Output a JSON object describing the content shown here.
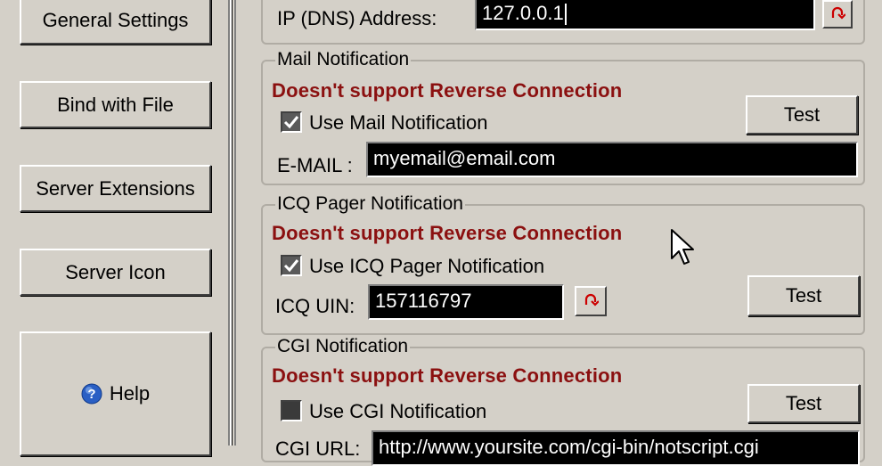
{
  "sidebar": {
    "buttons": [
      {
        "label": "General Settings"
      },
      {
        "label": "Bind with File"
      },
      {
        "label": "Server Extensions"
      },
      {
        "label": "Server Icon"
      },
      {
        "label": "Help"
      }
    ]
  },
  "top": {
    "ip_label": "IP (DNS) Address:",
    "ip_value": "127.0.0.1"
  },
  "mail": {
    "title": "Mail Notification",
    "warning": "Doesn't support Reverse Connection",
    "checkbox_label": "Use Mail Notification",
    "checked": true,
    "test_label": "Test",
    "email_label": "E-MAIL :",
    "email_value": "myemail@email.com"
  },
  "icq": {
    "title": "ICQ Pager Notification",
    "warning": "Doesn't support Reverse Connection",
    "checkbox_label": "Use ICQ Pager Notification",
    "checked": true,
    "uin_label": "ICQ UIN:",
    "uin_value": "157116797",
    "test_label": "Test"
  },
  "cgi": {
    "title": "CGI Notification",
    "warning": "Doesn't support Reverse Connection",
    "checkbox_label": "Use CGI Notification",
    "checked": false,
    "test_label": "Test",
    "url_label": "CGI URL:",
    "url_value": "http://www.yoursite.com/cgi-bin/notscript.cgi"
  },
  "colors": {
    "warning": "#8b1010",
    "field_bg": "#000000",
    "reset_icon": "#cc0000"
  }
}
